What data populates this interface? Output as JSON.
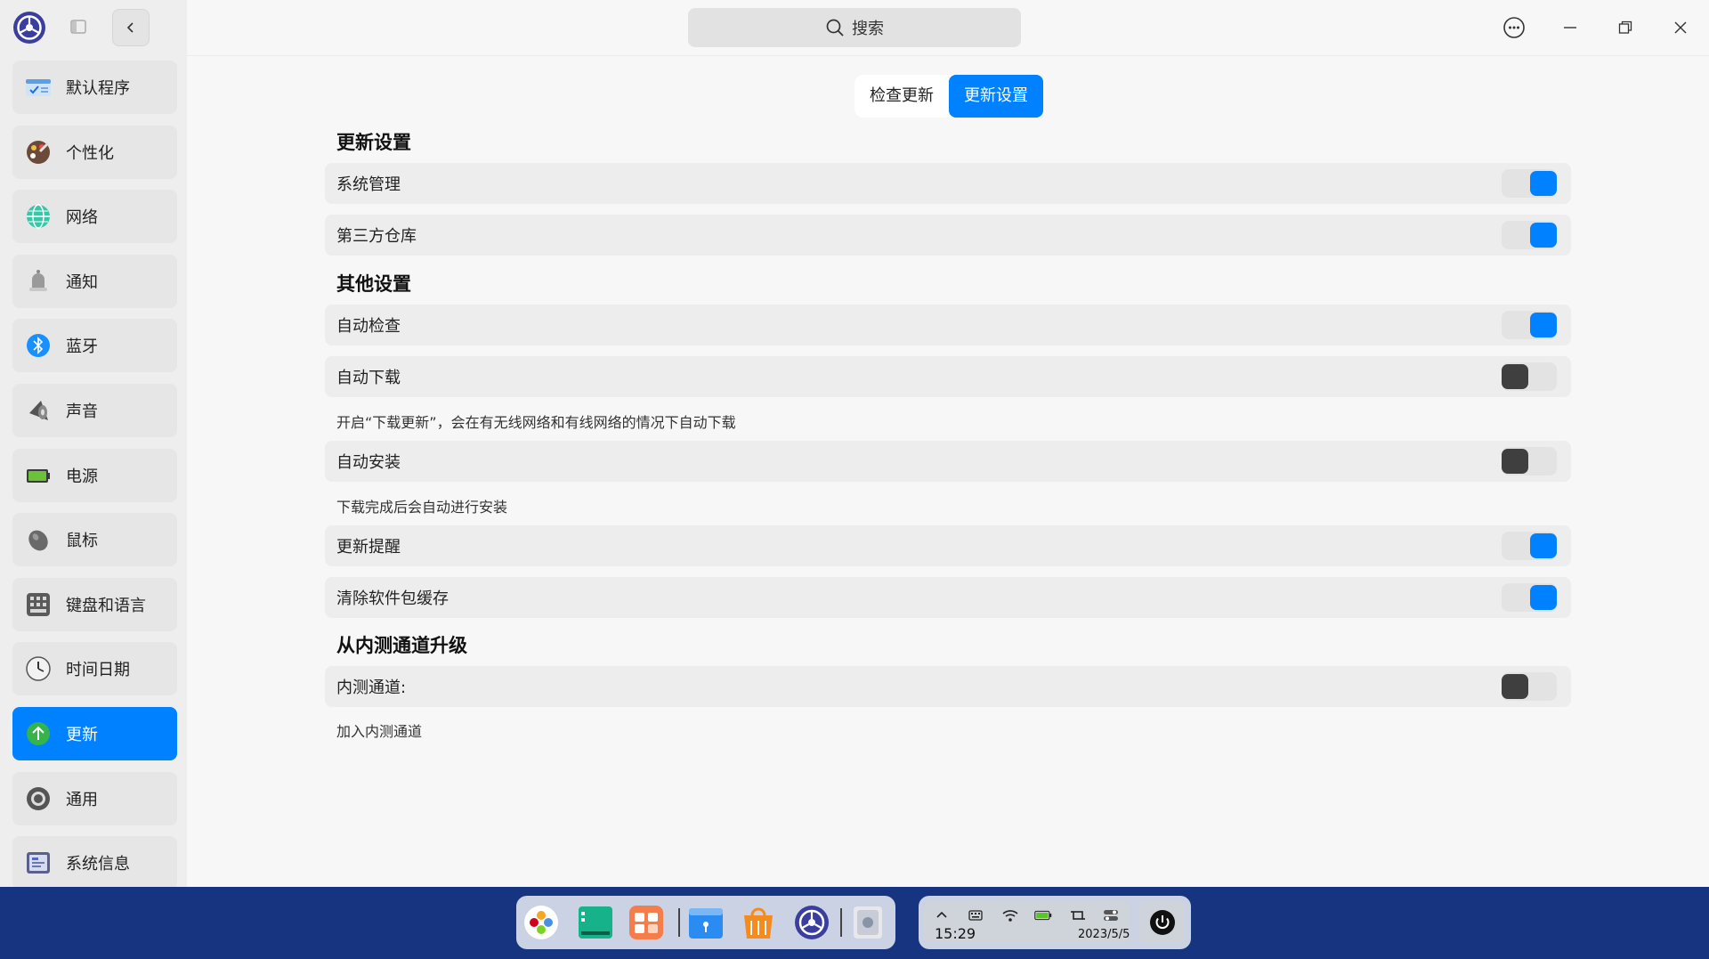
{
  "window": {
    "search_placeholder": "搜索"
  },
  "sidebar": {
    "items": [
      {
        "label": "默认程序",
        "icon": "default-apps-icon"
      },
      {
        "label": "个性化",
        "icon": "personalization-icon"
      },
      {
        "label": "网络",
        "icon": "network-icon"
      },
      {
        "label": "通知",
        "icon": "notification-bell-icon"
      },
      {
        "label": "蓝牙",
        "icon": "bluetooth-icon"
      },
      {
        "label": "声音",
        "icon": "speaker-icon"
      },
      {
        "label": "电源",
        "icon": "battery-icon"
      },
      {
        "label": "鼠标",
        "icon": "mouse-icon"
      },
      {
        "label": "键盘和语言",
        "icon": "keyboard-icon"
      },
      {
        "label": "时间日期",
        "icon": "clock-icon"
      },
      {
        "label": "更新",
        "icon": "update-arrow-icon",
        "active": true
      },
      {
        "label": "通用",
        "icon": "general-icon"
      },
      {
        "label": "系统信息",
        "icon": "system-info-icon"
      }
    ]
  },
  "tabs": {
    "check": "检查更新",
    "settings": "更新设置",
    "active": "settings"
  },
  "sections": {
    "update_settings": "更新设置",
    "other_settings": "其他设置",
    "internal_channel": "从内测通道升级"
  },
  "rows": {
    "system_management": {
      "label": "系统管理",
      "enabled": true
    },
    "third_party_repo": {
      "label": "第三方仓库",
      "enabled": true
    },
    "auto_check": {
      "label": "自动检查",
      "enabled": true
    },
    "auto_download": {
      "label": "自动下载",
      "enabled": false,
      "desc": "开启“下载更新”，会在有无线网络和有线网络的情况下自动下载"
    },
    "auto_install": {
      "label": "自动安装",
      "enabled": false,
      "desc": "下载完成后会自动进行安装"
    },
    "update_reminder": {
      "label": "更新提醒",
      "enabled": true
    },
    "clear_cache": {
      "label": "清除软件包缓存",
      "enabled": true
    },
    "internal_channel": {
      "label": "内测通道:",
      "enabled": false,
      "desc": "加入内测通道"
    }
  },
  "taskbar": {
    "time": "15:29",
    "date": "2023/5/5",
    "dock_apps": [
      "launcher-icon",
      "terminal-icon",
      "multitask-icon",
      "file-manager-icon",
      "app-store-icon",
      "control-center-icon",
      "trash-icon"
    ]
  },
  "colors": {
    "accent": "#0081ff",
    "taskbar": "#16347f",
    "toggle_off_knob": "#3f3f3f"
  }
}
